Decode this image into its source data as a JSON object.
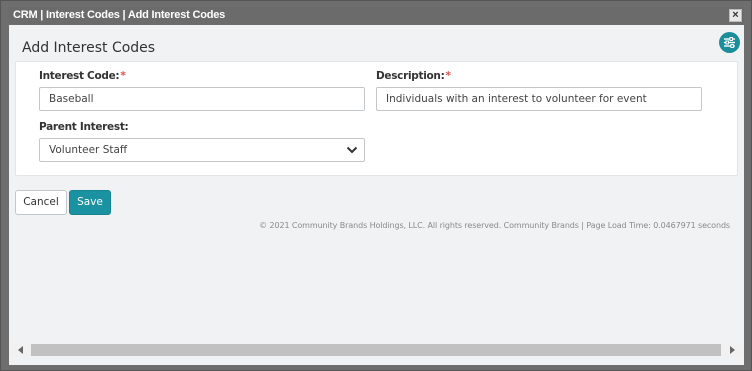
{
  "window": {
    "title": "CRM | Interest Codes | Add Interest Codes",
    "close_label": "×"
  },
  "page": {
    "heading": "Add Interest Codes",
    "settings_icon": "sliders-icon"
  },
  "form": {
    "interest_code": {
      "label": "Interest Code:",
      "required_mark": "*",
      "value": "Baseball"
    },
    "description": {
      "label": "Description:",
      "required_mark": "*",
      "value": "Individuals with an interest to volunteer for event"
    },
    "parent_interest": {
      "label": "Parent Interest:",
      "selected": "Volunteer Staff"
    }
  },
  "actions": {
    "cancel_label": "Cancel",
    "save_label": "Save"
  },
  "footer": {
    "text": "© 2021 Community Brands Holdings, LLC. All rights reserved. Community Brands | Page Load Time: 0.0467971 seconds"
  },
  "colors": {
    "accent": "#1a92a2",
    "required": "#d9534f"
  }
}
